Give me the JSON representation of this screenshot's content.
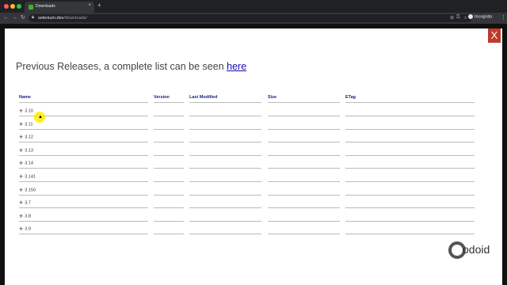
{
  "browser": {
    "tab_title": "Downloads",
    "url_host": "selenium.dev",
    "url_path": "/downloads/",
    "profile_label": "Incognito"
  },
  "modal": {
    "close_label": "X",
    "heading_text": "Previous Releases, a complete list can be seen ",
    "heading_link": "here"
  },
  "table": {
    "columns": [
      "Name",
      "Version",
      "Last Modified",
      "Size",
      "ETag"
    ],
    "rows": [
      "3.10",
      "3.11",
      "3.12",
      "3.13",
      "3.14",
      "3.141",
      "3.150",
      "3.7",
      "3.8",
      "3.9"
    ]
  },
  "logo": {
    "text": "odoid"
  },
  "colors": {
    "accent_close": "#c0392b",
    "link": "#1a0dab",
    "header_text": "#1a237e"
  }
}
